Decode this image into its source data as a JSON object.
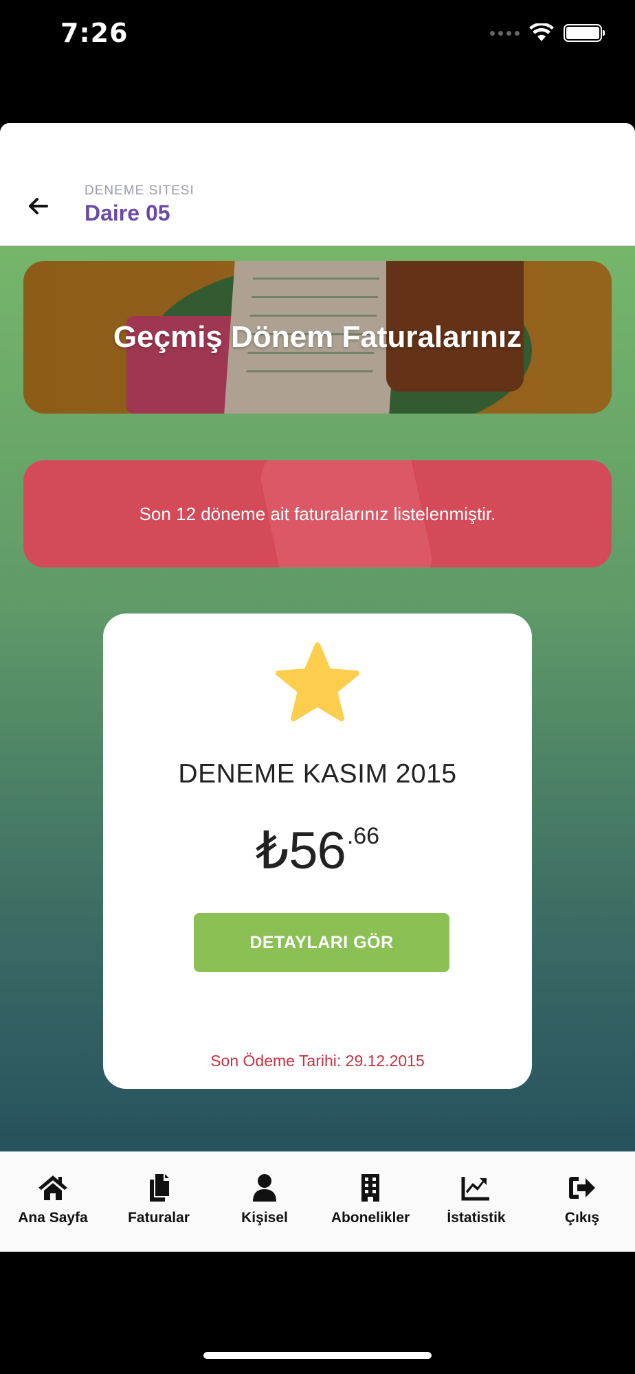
{
  "status_bar": {
    "time": "7:26"
  },
  "header": {
    "subtitle": "DENEME SITESI",
    "title": "Daire 05"
  },
  "banner": {
    "title": "Geçmiş Dönem Faturalarınız"
  },
  "info": {
    "message": "Son 12 döneme ait faturalarınız listelenmiştir."
  },
  "invoice": {
    "title": "DENEME KASIM 2015",
    "currency_symbol": "₺",
    "amount_integer": "56",
    "amount_decimal": ".66",
    "details_button": "DETAYLARI GÖR",
    "due_date": "Son Ödeme Tarihi: 29.12.2015"
  },
  "tabs": [
    {
      "label": "Ana Sayfa",
      "icon": "home-icon"
    },
    {
      "label": "Faturalar",
      "icon": "documents-icon"
    },
    {
      "label": "Kişisel",
      "icon": "user-icon"
    },
    {
      "label": "Abonelikler",
      "icon": "building-icon"
    },
    {
      "label": "İstatistik",
      "icon": "chart-icon"
    },
    {
      "label": "Çıkış",
      "icon": "logout-icon"
    }
  ],
  "colors": {
    "accent_purple": "#6a4aa8",
    "button_green": "#8bc154",
    "info_red": "#d44a58",
    "due_date_red": "#c9303f",
    "star_yellow": "#fdce4e"
  }
}
